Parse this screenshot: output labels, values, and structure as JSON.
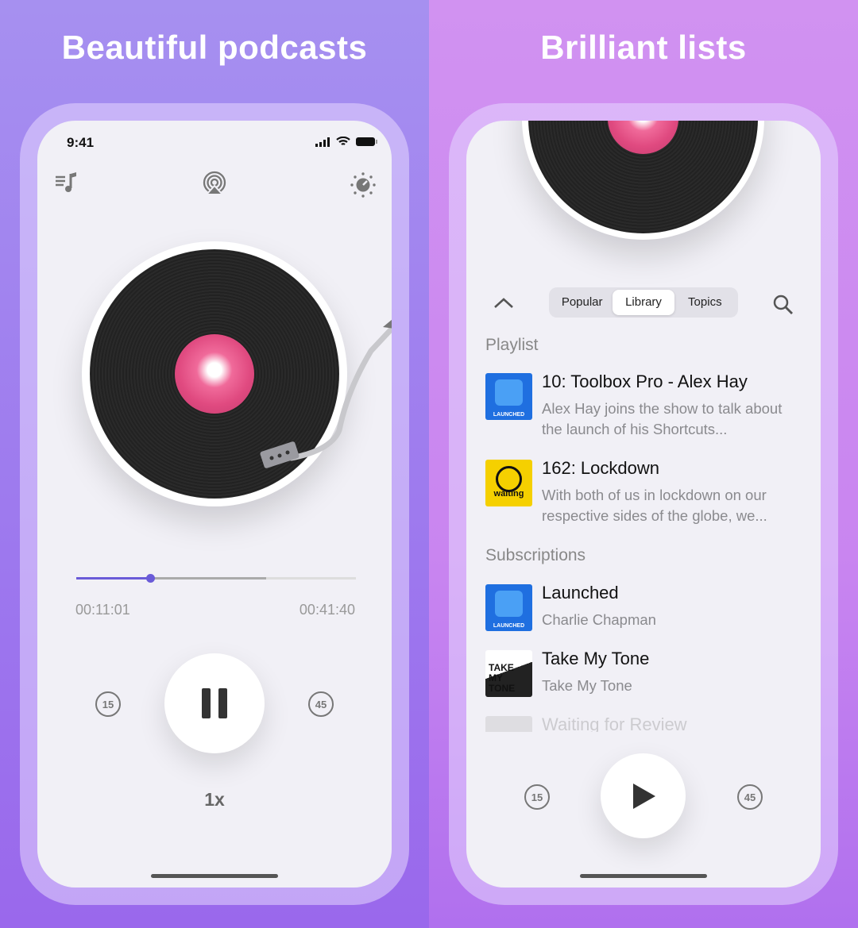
{
  "left": {
    "headline": "Beautiful podcasts",
    "status_time": "9:41",
    "icons": {
      "queue": "music-queue-icon",
      "airplay": "airplay-icon",
      "settings": "sleep-timer-dial-icon"
    },
    "progress": {
      "elapsed": "00:11:01",
      "duration": "00:41:40",
      "played_percent": 26.4,
      "buffered_percent": 68
    },
    "skip_back": "15",
    "skip_forward": "45",
    "state": "pause",
    "speed": "1x"
  },
  "right": {
    "headline": "Brilliant lists",
    "tabs": [
      {
        "label": "Popular"
      },
      {
        "label": "Library",
        "selected": true
      },
      {
        "label": "Topics"
      }
    ],
    "sections": {
      "playlist": "Playlist",
      "subscriptions": "Subscriptions"
    },
    "playlist": [
      {
        "title": "10: Toolbox Pro - Alex Hay",
        "subtitle": "Alex Hay joins the show to talk about the launch of his Shortcuts...",
        "art_text": "LAUNCHED"
      },
      {
        "title": "162: Lockdown",
        "subtitle": "With both of us in lockdown on our respective sides of the globe, we...",
        "art_text": "waiting"
      }
    ],
    "subscriptions": [
      {
        "title": "Launched",
        "subtitle": "Charlie Chapman",
        "art_text": "LAUNCHED"
      },
      {
        "title": "Take My Tone",
        "subtitle": "Take My Tone",
        "art_text": "TAKE MY TONE"
      },
      {
        "title": "Waiting for Review"
      }
    ],
    "skip_back": "15",
    "skip_forward": "45",
    "state": "play"
  },
  "colors": {
    "accent": "#6a5bd8",
    "launched_blue": "#1f6fe0",
    "waiting_yellow": "#f5d000"
  }
}
